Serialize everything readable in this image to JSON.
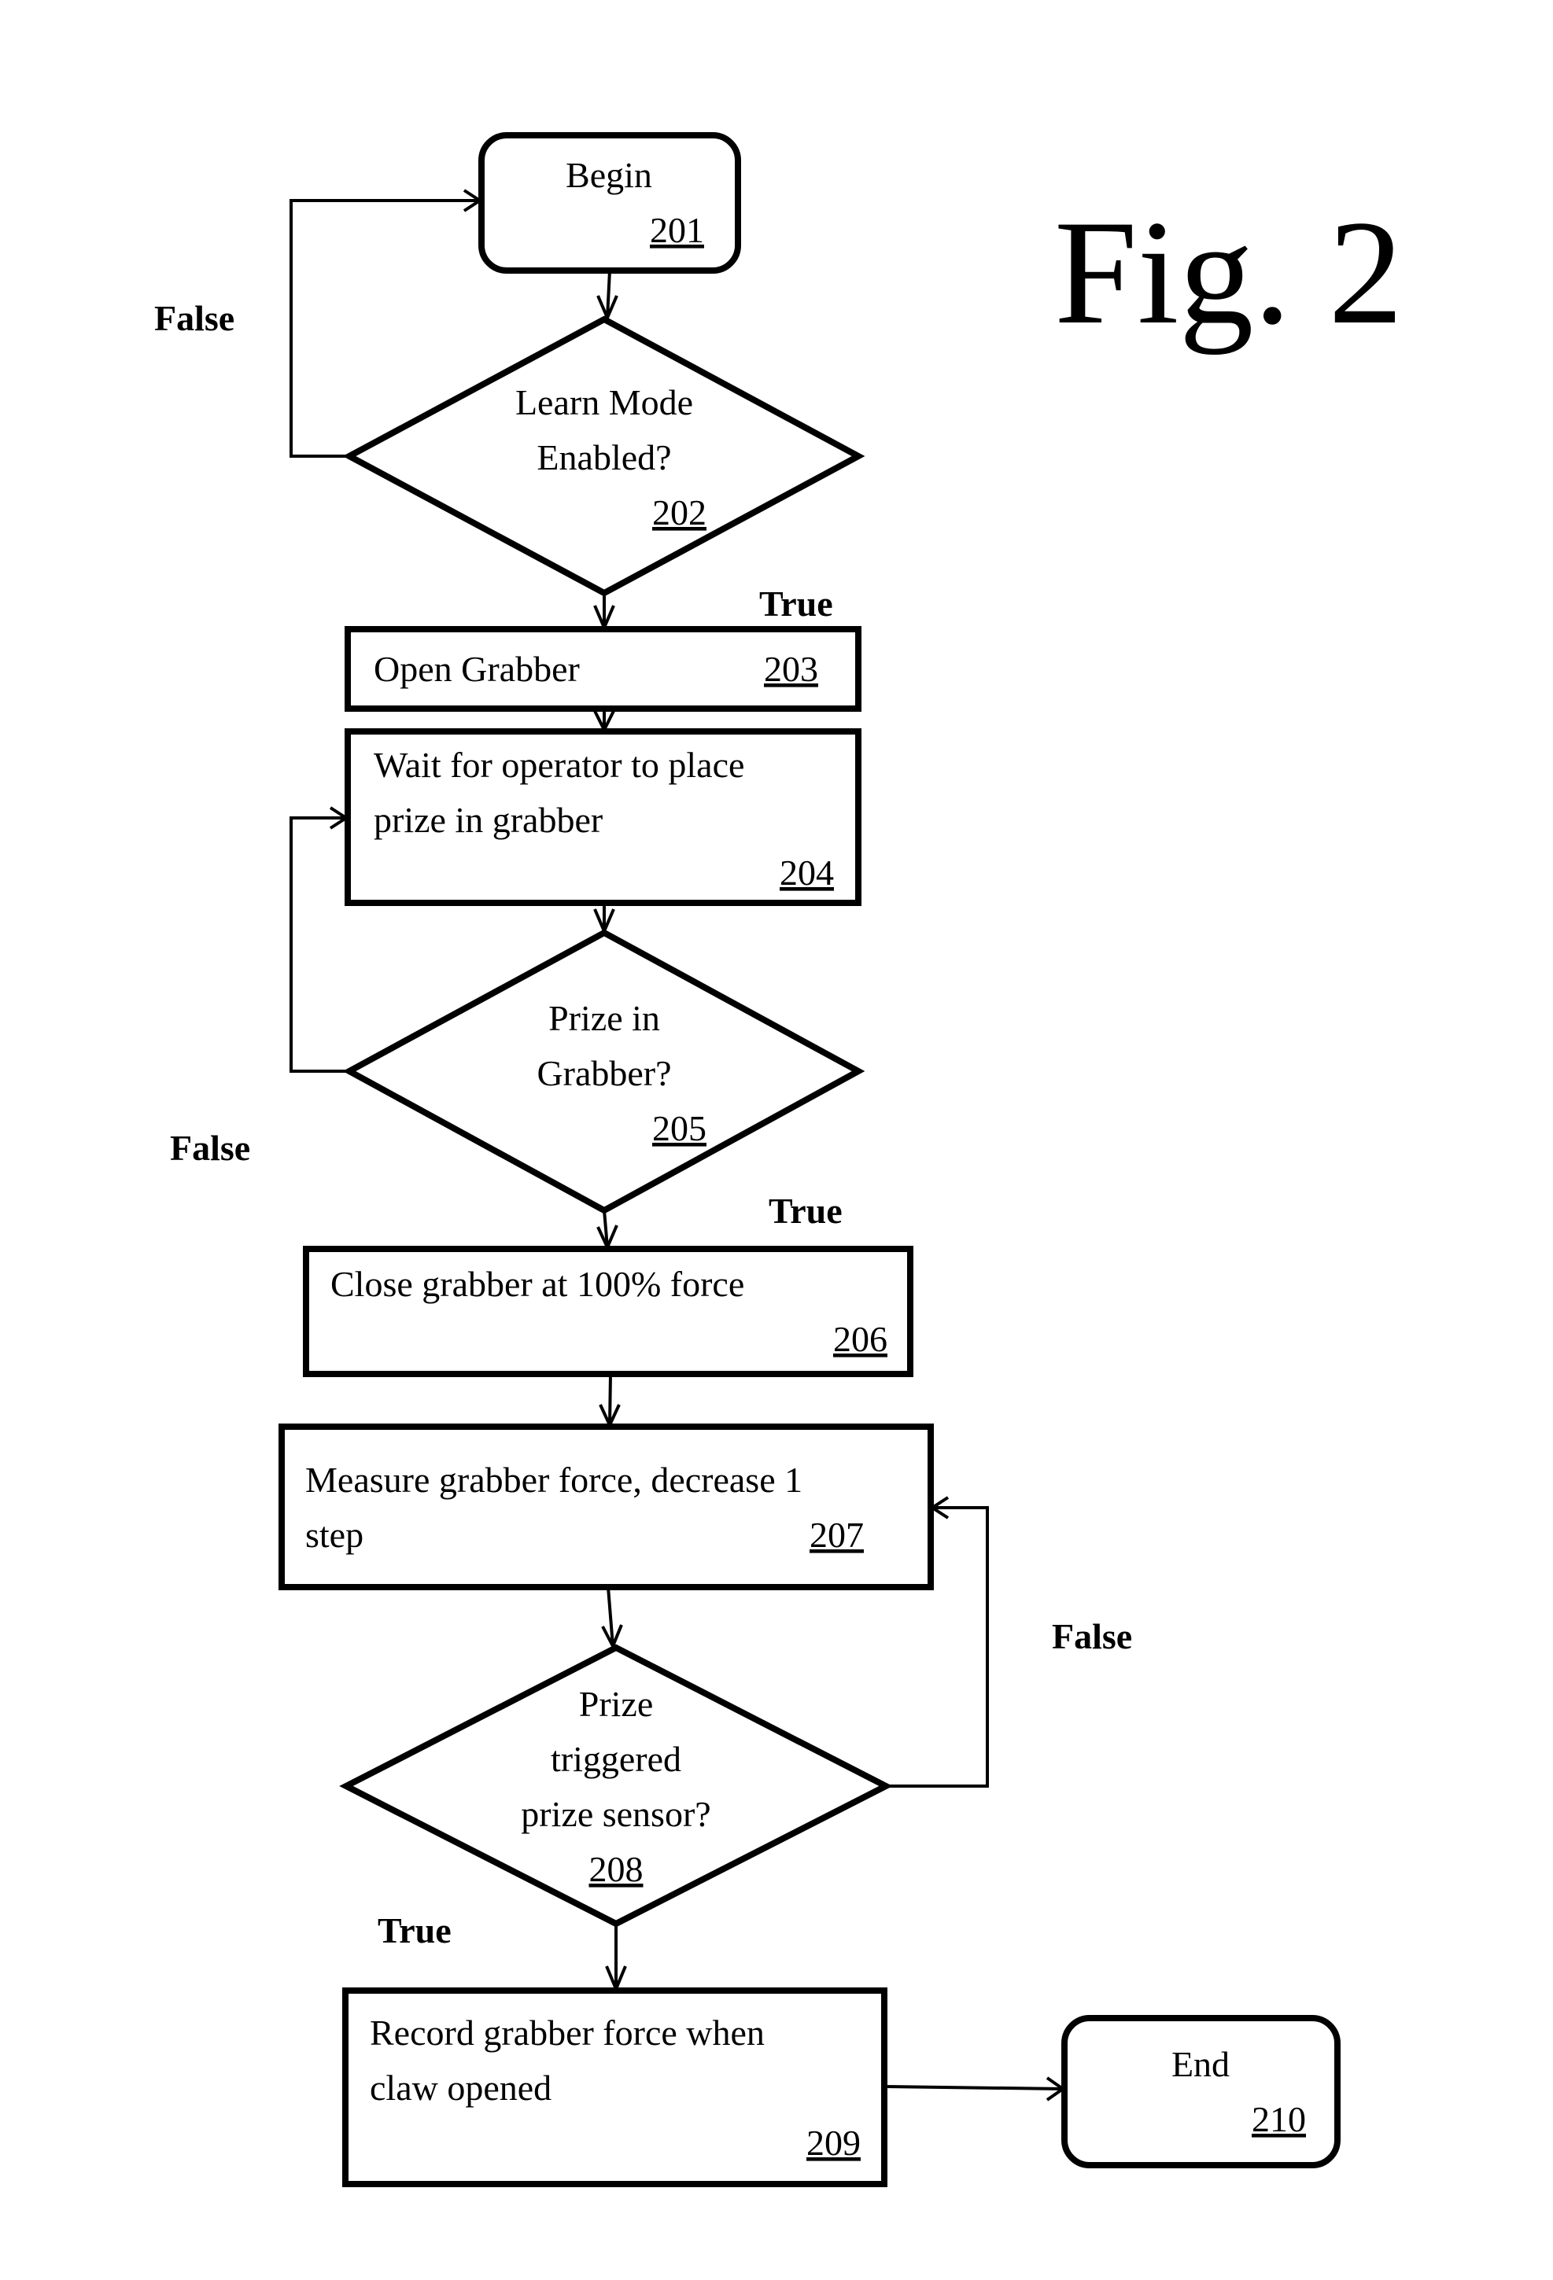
{
  "figure_label": "Fig. 2",
  "nodes": {
    "n201": {
      "type": "terminal",
      "lines": [
        "Begin"
      ],
      "ref": "201"
    },
    "n202": {
      "type": "decision",
      "lines": [
        "Learn Mode",
        "Enabled?"
      ],
      "ref": "202"
    },
    "n203": {
      "type": "process",
      "lines": [
        "Open Grabber"
      ],
      "ref": "203"
    },
    "n204": {
      "type": "process",
      "lines": [
        "Wait for operator to place",
        "prize in grabber"
      ],
      "ref": "204"
    },
    "n205": {
      "type": "decision",
      "lines": [
        "Prize in",
        "Grabber?"
      ],
      "ref": "205"
    },
    "n206": {
      "type": "process",
      "lines": [
        "Close grabber at 100% force"
      ],
      "ref": "206"
    },
    "n207": {
      "type": "process",
      "lines": [
        "Measure grabber force, decrease 1",
        "step"
      ],
      "ref": "207"
    },
    "n208": {
      "type": "decision",
      "lines": [
        "Prize",
        "triggered",
        "prize sensor?"
      ],
      "ref": "208"
    },
    "n209": {
      "type": "process",
      "lines": [
        "Record grabber force when",
        "claw opened"
      ],
      "ref": "209"
    },
    "n210": {
      "type": "terminal",
      "lines": [
        "End"
      ],
      "ref": "210"
    }
  },
  "edges": [
    {
      "from": "201",
      "to": "202",
      "label": ""
    },
    {
      "from": "202",
      "to": "201",
      "label": "False"
    },
    {
      "from": "202",
      "to": "203",
      "label": "True"
    },
    {
      "from": "203",
      "to": "204",
      "label": ""
    },
    {
      "from": "204",
      "to": "205",
      "label": ""
    },
    {
      "from": "205",
      "to": "204",
      "label": "False"
    },
    {
      "from": "205",
      "to": "206",
      "label": "True"
    },
    {
      "from": "206",
      "to": "207",
      "label": ""
    },
    {
      "from": "207",
      "to": "208",
      "label": ""
    },
    {
      "from": "208",
      "to": "207",
      "label": "False"
    },
    {
      "from": "208",
      "to": "209",
      "label": "True"
    },
    {
      "from": "209",
      "to": "210",
      "label": ""
    }
  ],
  "edge_labels": {
    "false_202": "False",
    "true_202": "True",
    "false_205": "False",
    "true_205": "True",
    "false_208": "False",
    "true_208": "True"
  }
}
